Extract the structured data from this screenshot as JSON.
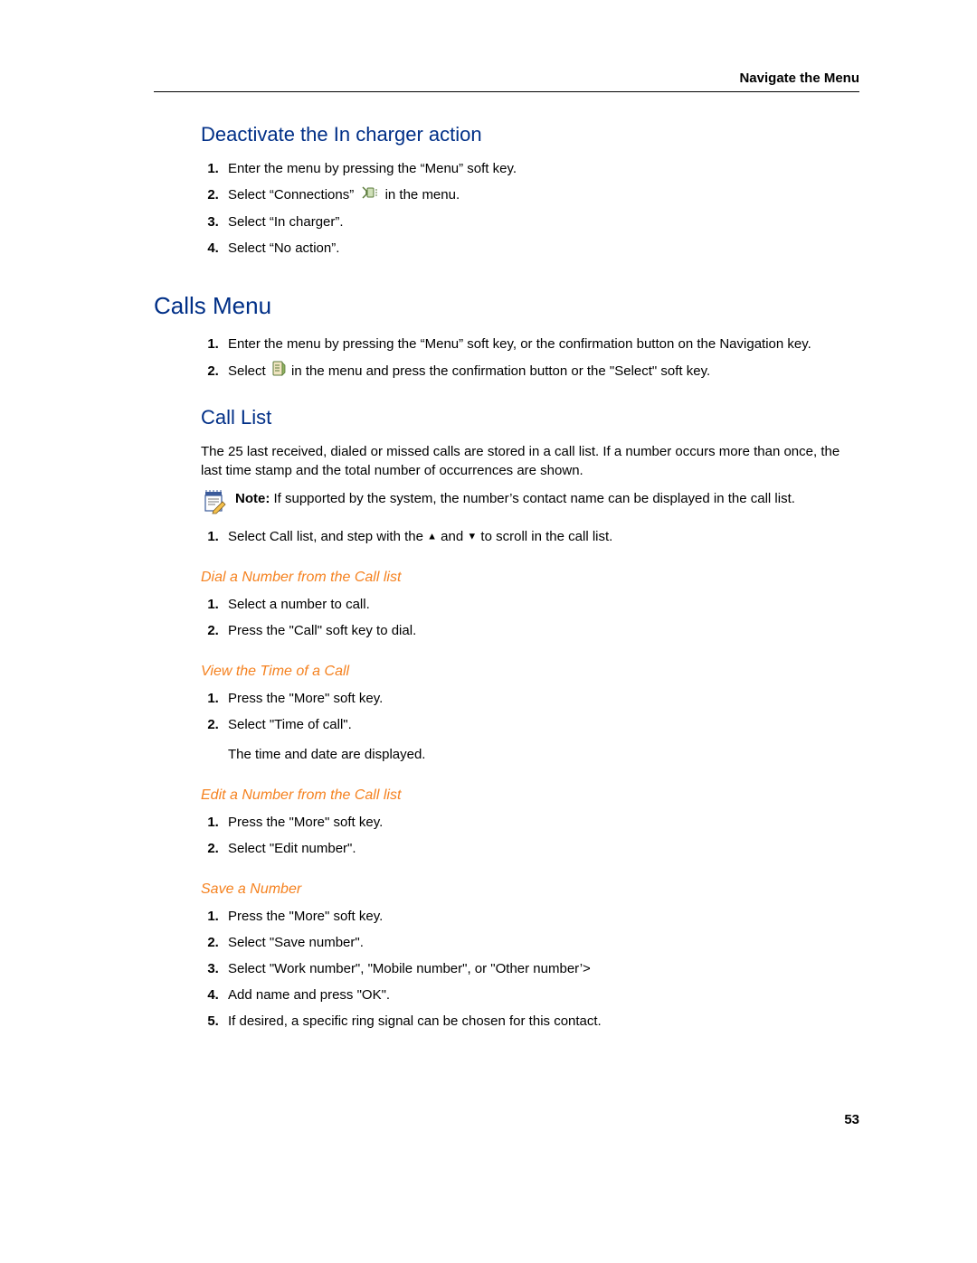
{
  "header": {
    "title": "Navigate the Menu"
  },
  "sec1": {
    "heading": "Deactivate the In charger action",
    "steps": [
      "Enter the menu by pressing the “Menu” soft key.",
      {
        "pre": "Select “Connections” ",
        "post": " in the menu."
      },
      "Select “In charger”.",
      "Select “No action”."
    ]
  },
  "sec2": {
    "heading": "Calls Menu",
    "steps": [
      "Enter the menu by pressing the “Menu” soft key, or the confirmation button on the Navigation key.",
      {
        "pre": "Select ",
        "post": " in the menu and press the confirmation button or the \"Select\" soft key."
      }
    ]
  },
  "sec3": {
    "heading": "Call List",
    "para": "The 25 last received, dialed or missed calls are stored in a call list. If a number occurs more than once, the last time stamp and the total number of occurrences are shown.",
    "note_label": "Note:",
    "note_text": " If supported by the system, the number’s contact name can be displayed in the call list.",
    "step1": {
      "pre": "Select Call list, and step with the ",
      "mid": " and ",
      "post": " to scroll in the call list."
    }
  },
  "dial": {
    "heading": "Dial a Number from the Call list",
    "steps": [
      "Select a number to call.",
      "Press the \"Call\" soft key to dial."
    ]
  },
  "viewtime": {
    "heading": "View the Time of a Call",
    "steps": [
      "Press the \"More\" soft key.",
      "Select \"Time of call\"."
    ],
    "trailer": "The time and date are displayed."
  },
  "editnum": {
    "heading": "Edit a Number from the Call list",
    "steps": [
      "Press the \"More\" soft key.",
      "Select \"Edit number\"."
    ]
  },
  "savenum": {
    "heading": "Save a Number",
    "steps": [
      "Press the \"More\" soft key.",
      "Select \"Save number\".",
      "Select \"Work number\", \"Mobile number\", or \"Other number’>",
      "Add name and press \"OK\".",
      "If desired, a specific ring signal can be chosen for this contact."
    ]
  },
  "footer": {
    "page": "53"
  }
}
